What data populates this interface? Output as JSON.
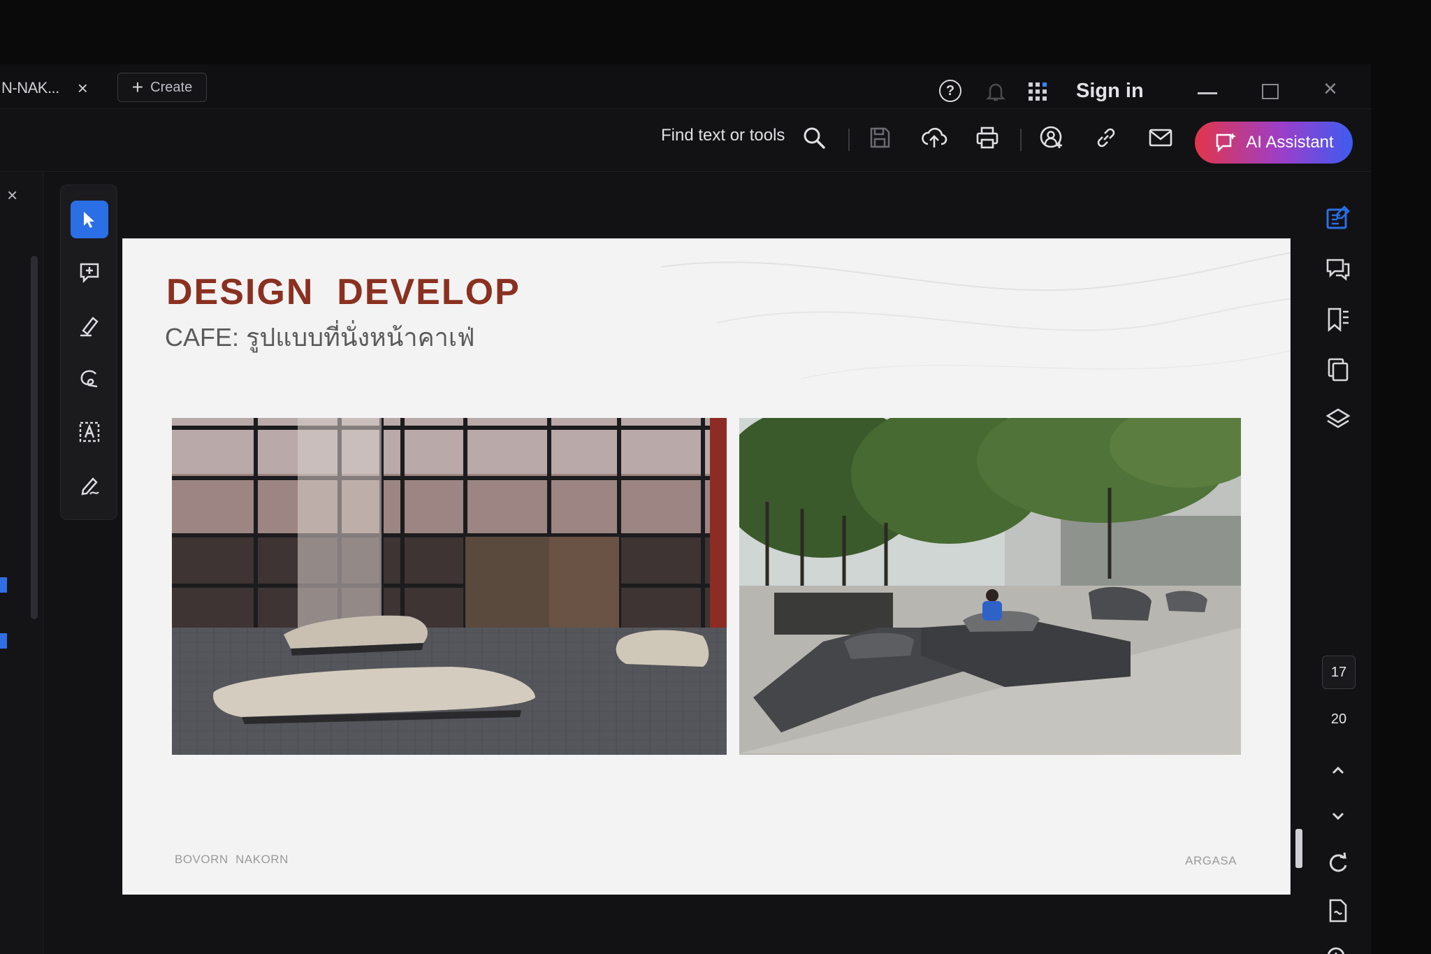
{
  "tabs": {
    "document_tab": "N-NAK...",
    "close_symbol": "×",
    "create_label": "Create"
  },
  "header": {
    "sign_in": "Sign in",
    "help_symbol": "?"
  },
  "toolbar": {
    "find_label": "Find text or tools",
    "ai_assistant_label": "AI Assistant",
    "icons": [
      "search-icon",
      "save-icon",
      "upload-cloud-icon",
      "print-icon",
      "share-user-icon",
      "link-icon",
      "mail-icon"
    ]
  },
  "tools": {
    "items": [
      "select-cursor-icon",
      "add-comment-icon",
      "highlight-pen-icon",
      "draw-freeform-icon",
      "text-recognition-icon",
      "fill-sign-icon"
    ],
    "active_index": 0
  },
  "right_rail": {
    "icons": [
      "edit-pdf-icon",
      "comments-icon",
      "bookmarks-icon",
      "pages-icon",
      "layers-icon",
      "rotate-icon",
      "document-icon",
      "zoom-in-icon",
      "zoom-out-icon"
    ],
    "current_page": "17",
    "total_pages": "20"
  },
  "slide": {
    "title": "DESIGN  DEVELOP",
    "subtitle": "CAFE: รูปแบบที่นั่งหน้าคาเฟ่",
    "footer_left": "BOVORN  NAKORN",
    "footer_right": "ARGASA"
  },
  "colors": {
    "accent_blue": "#2b6fe6",
    "title_red": "#8a3020",
    "ai_gradient_start": "#e2364a",
    "ai_gradient_end": "#3d5cf0"
  }
}
